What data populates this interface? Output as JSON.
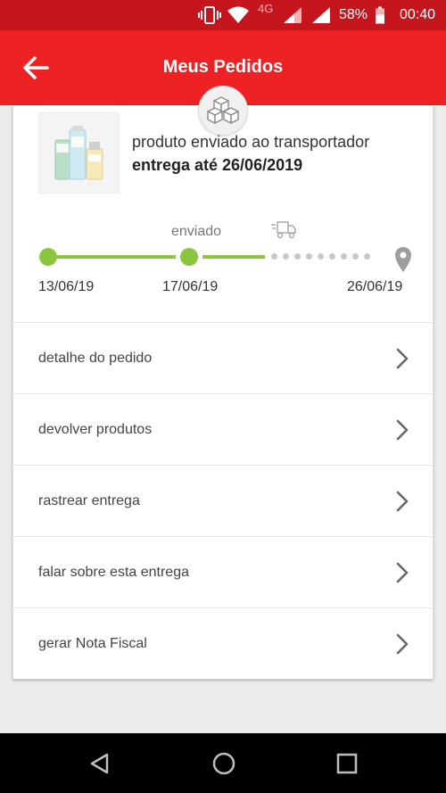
{
  "status_bar": {
    "network_type": "4G",
    "battery_percent": "58%",
    "time": "00:40",
    "icons": [
      "vibrate-icon",
      "wifi-icon",
      "signal-icon",
      "signal-icon",
      "battery-icon"
    ]
  },
  "header": {
    "title": "Meus Pedidos",
    "back_icon": "arrow-left-icon"
  },
  "order": {
    "badge_icon": "boxes-icon",
    "product_image": "product-thumbnail",
    "status_text": "produto enviado ao transportador",
    "delivery_text": "entrega até 26/06/2019"
  },
  "tracking": {
    "step_label": "enviado",
    "dates": [
      "13/06/19",
      "17/06/19",
      "26/06/19"
    ],
    "icons": [
      "truck-icon",
      "location-pin-icon"
    ],
    "accent_color": "#8cc63f"
  },
  "menu": [
    {
      "label": "detalhe do pedido"
    },
    {
      "label": "devolver produtos"
    },
    {
      "label": "rastrear entrega"
    },
    {
      "label": "falar sobre esta entrega"
    },
    {
      "label": "gerar Nota Fiscal"
    }
  ],
  "nav_bar": {
    "buttons": [
      "back-triangle-icon",
      "home-circle-icon",
      "recents-square-icon"
    ]
  },
  "colors": {
    "brand_red": "#ee2124",
    "status_red": "#c4161c",
    "progress_green": "#8cc63f"
  }
}
